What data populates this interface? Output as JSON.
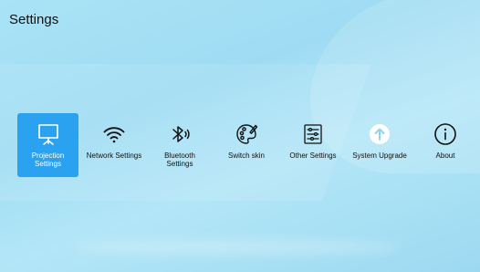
{
  "header": {
    "title": "Settings"
  },
  "menu": {
    "items": [
      {
        "label": "Projection\nSettings",
        "icon": "projection-screen-icon",
        "selected": true
      },
      {
        "label": "Network Settings",
        "icon": "wifi-icon",
        "selected": false
      },
      {
        "label": "Bluetooth\nSettings",
        "icon": "bluetooth-icon",
        "selected": false
      },
      {
        "label": "Switch skin",
        "icon": "palette-icon",
        "selected": false
      },
      {
        "label": "Other Settings",
        "icon": "sliders-icon",
        "selected": false
      },
      {
        "label": "System Upgrade",
        "icon": "upgrade-arrow-icon",
        "selected": false
      },
      {
        "label": "About",
        "icon": "info-icon",
        "selected": false
      }
    ]
  },
  "colors": {
    "selected_tile": "#2aa2ef",
    "background": "#a9e3f6",
    "text": "#111111"
  }
}
